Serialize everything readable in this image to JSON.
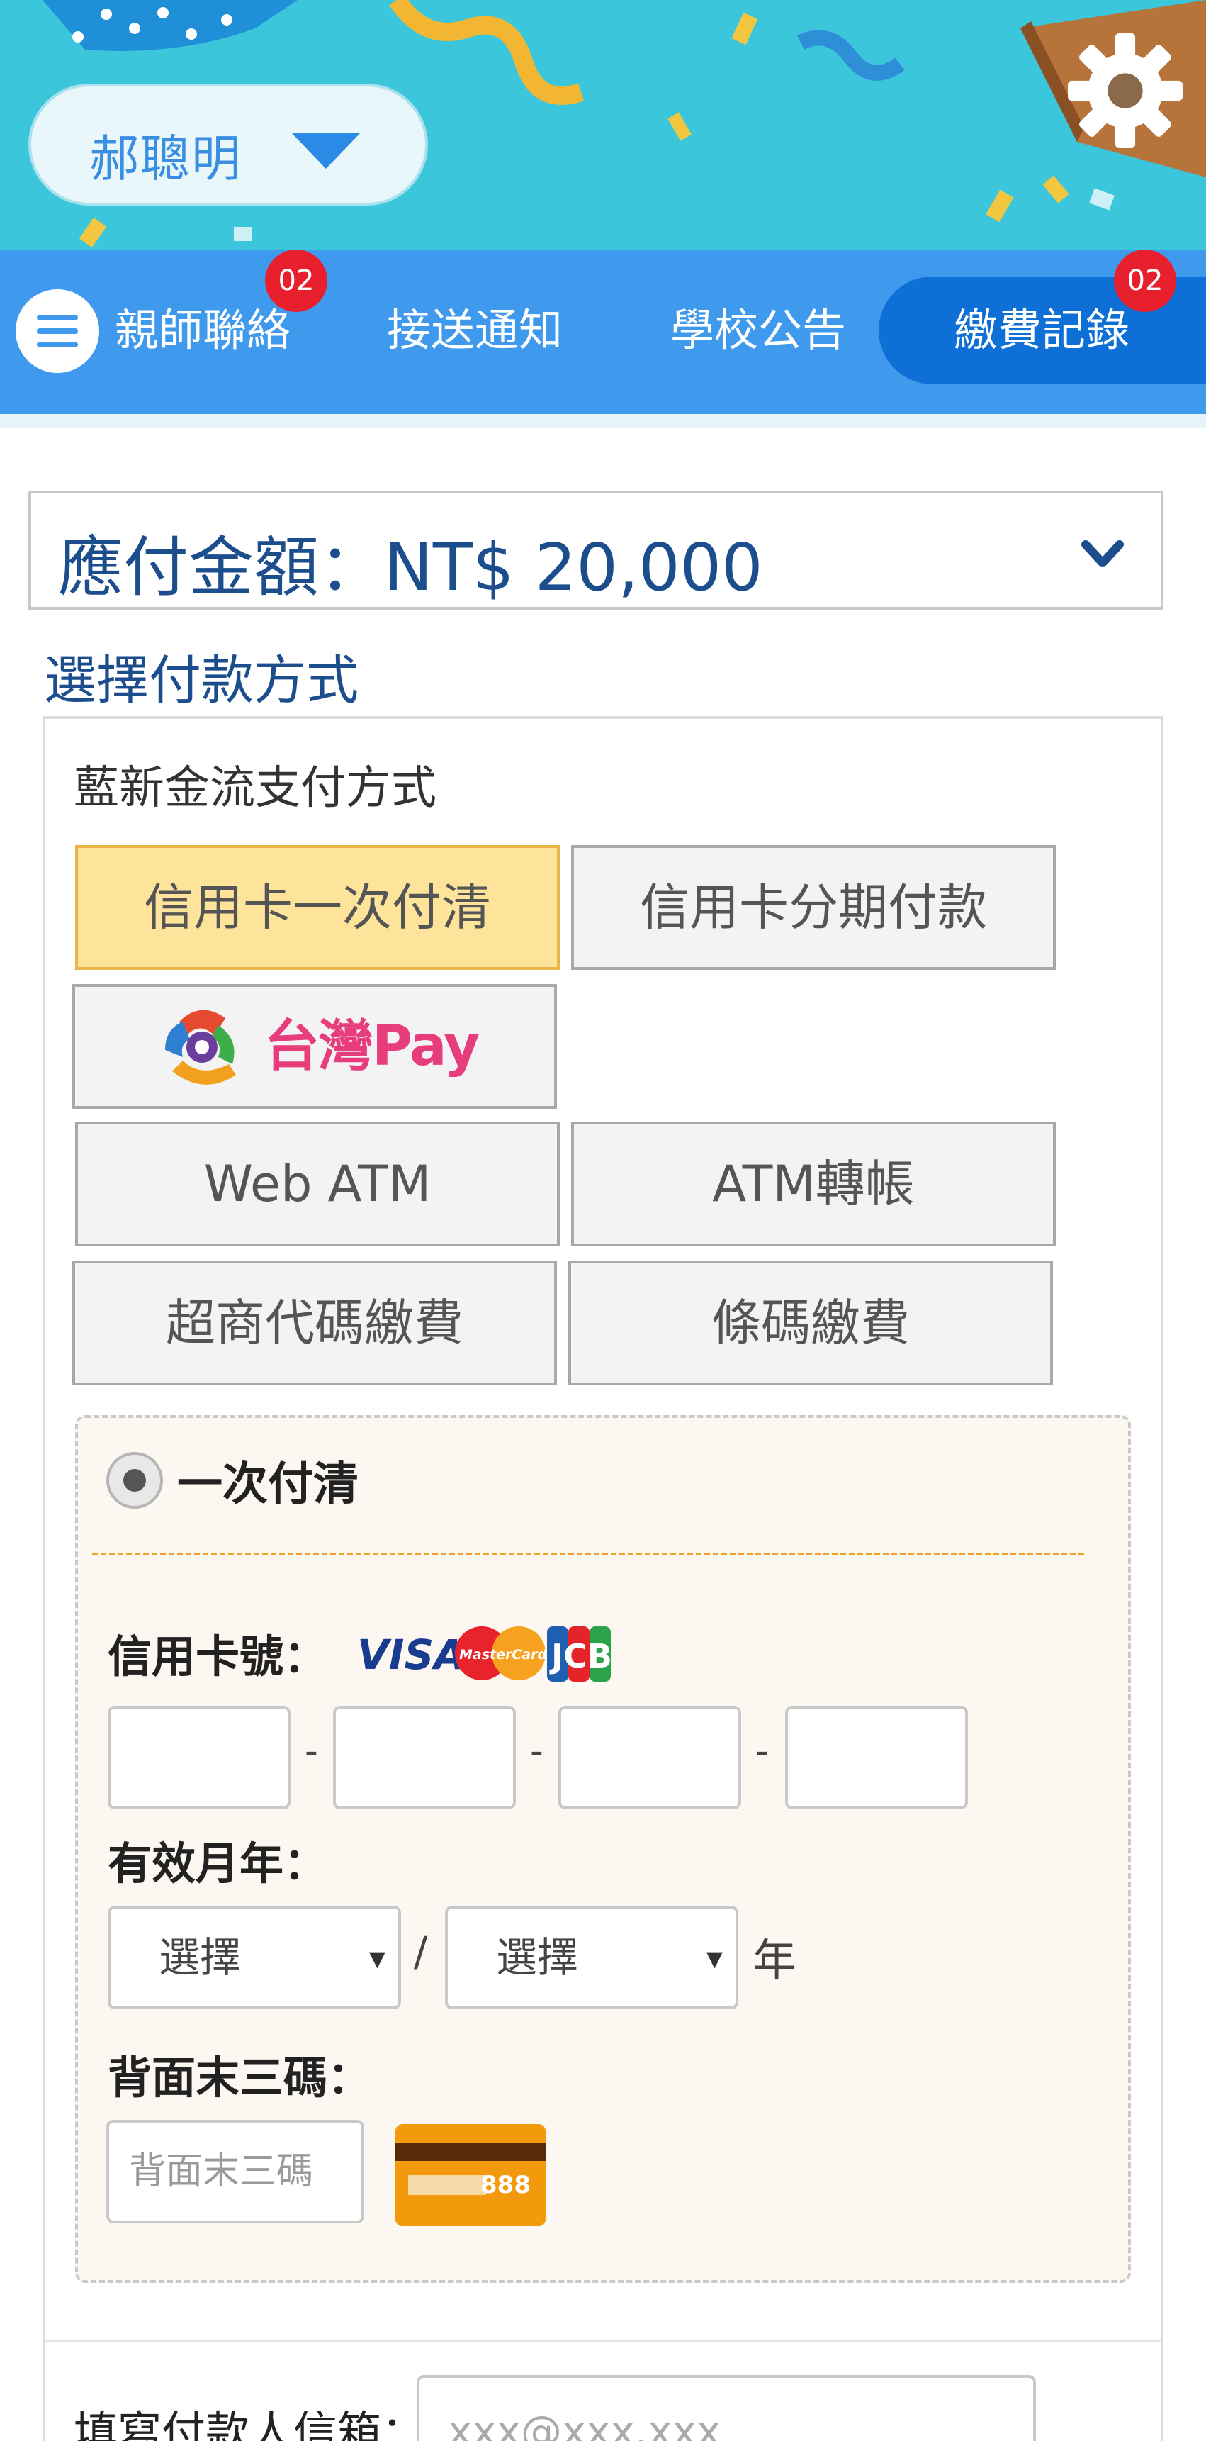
{
  "header": {
    "user_name": "郝聰明"
  },
  "nav": {
    "items": [
      {
        "label": "親師聯絡",
        "badge": "02"
      },
      {
        "label": "接送通知"
      },
      {
        "label": "學校公告"
      },
      {
        "label": "繳費記錄",
        "badge": "02",
        "active": true
      }
    ]
  },
  "payment": {
    "amount_label": "應付金額：NT$ 20,000",
    "section_title": "選擇付款方式",
    "provider_title": "藍新金流支付方式",
    "methods": [
      {
        "label": "信用卡一次付清",
        "selected": true
      },
      {
        "label": "信用卡分期付款"
      },
      {
        "label": "台灣Pay"
      },
      {
        "label": "Web ATM"
      },
      {
        "label": "ATM轉帳"
      },
      {
        "label": "超商代碼繳費"
      },
      {
        "label": "條碼繳費"
      }
    ],
    "option_label": "一次付清",
    "card_number_label": "信用卡號：",
    "card_brands": [
      "VISA",
      "MasterCard",
      "JCB"
    ],
    "expiry_label": "有效月年：",
    "month_select": "選擇",
    "year_select": "選擇",
    "year_unit": "年",
    "cvv_label": "背面末三碼：",
    "cvv_placeholder": "背面末三碼",
    "cvv_example": "888",
    "email_label": "填寫付款人信箱：",
    "email_placeholder": "xxx@xxx.xxx"
  },
  "colors": {
    "banner": "#3cc6db",
    "nav": "#3f99ec",
    "nav_active": "#0e6fd6",
    "badge": "#e8202e",
    "selected_method": "#fde49a",
    "title_text": "#1c4d8c"
  }
}
